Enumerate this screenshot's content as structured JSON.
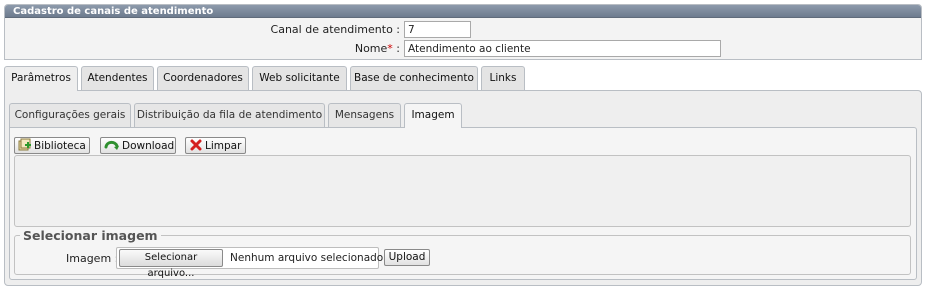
{
  "panel": {
    "title": "Cadastro de canais de atendimento"
  },
  "form": {
    "canal_label": "Canal de atendimento :",
    "canal_value": "7",
    "nome_label": "Nome",
    "nome_required_mark": "*",
    "nome_label_suffix": " :",
    "nome_value": "Atendimento ao cliente"
  },
  "main_tabs": [
    {
      "label": "Parâmetros",
      "active": true
    },
    {
      "label": "Atendentes"
    },
    {
      "label": "Coordenadores"
    },
    {
      "label": "Web solicitante"
    },
    {
      "label": "Base de conhecimento"
    },
    {
      "label": "Links"
    }
  ],
  "sub_tabs": [
    {
      "label": "Configurações gerais"
    },
    {
      "label": "Distribuição da fila de atendimento"
    },
    {
      "label": "Mensagens"
    },
    {
      "label": "Imagem",
      "active": true
    }
  ],
  "toolbar": {
    "biblioteca_label": "Biblioteca",
    "download_label": "Download",
    "limpar_label": "Limpar"
  },
  "image_section": {
    "legend": "Selecionar imagem",
    "field_label": "Imagem :",
    "choose_file_label": "Selecionar arquivo...",
    "no_file_text": "Nenhum arquivo selecionado.",
    "upload_label": "Upload"
  },
  "icons": {
    "biblioteca": "library-add-icon",
    "download": "download-icon",
    "limpar": "clear-icon"
  }
}
